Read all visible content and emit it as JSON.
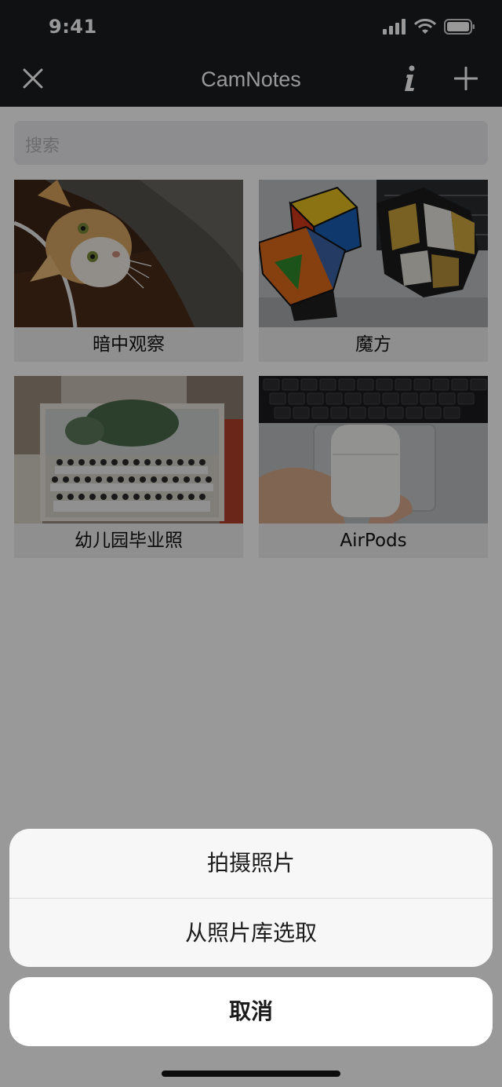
{
  "status": {
    "time": "9:41"
  },
  "nav": {
    "title": "CamNotes"
  },
  "search": {
    "placeholder": "搜索"
  },
  "items": [
    {
      "caption": "暗中观察"
    },
    {
      "caption": "魔方"
    },
    {
      "caption": "幼儿园毕业照"
    },
    {
      "caption": "AirPods"
    }
  ],
  "action_sheet": {
    "options": [
      {
        "label": "拍摄照片"
      },
      {
        "label": "从照片库选取"
      }
    ],
    "cancel_label": "取消"
  },
  "colors": {
    "nav_background": "#1c1d20",
    "overlay": "rgba(0,0,0,0.40)",
    "sheet_background": "#f7f7f7"
  },
  "icons": [
    "close-icon",
    "info-icon",
    "add-icon",
    "signal-icon",
    "wifi-icon",
    "battery-icon"
  ]
}
